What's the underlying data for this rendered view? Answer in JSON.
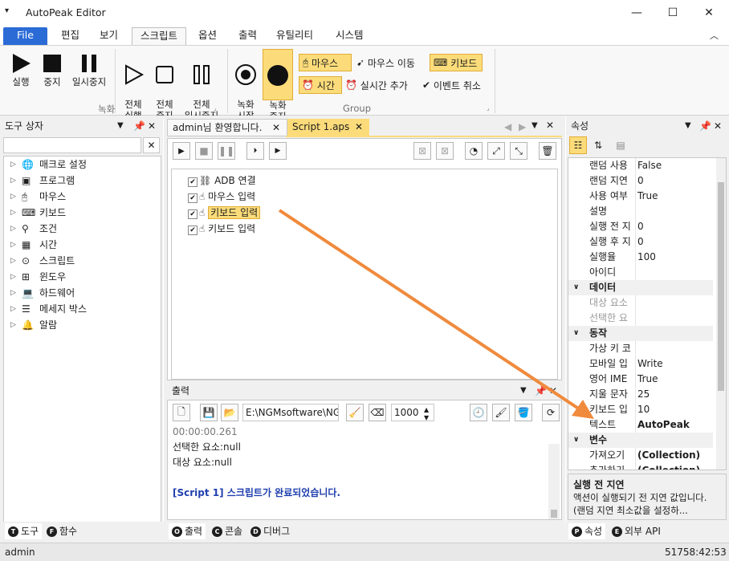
{
  "window": {
    "title": "AutoPeak Editor",
    "minimize": "—",
    "maximize": "☐",
    "close": "✕"
  },
  "menu": {
    "file": "File",
    "items": [
      "편집",
      "보기",
      "스크립트",
      "옵션",
      "출력",
      "유틸리티",
      "시스템"
    ]
  },
  "ribbon": {
    "run": "실행",
    "stop": "중지",
    "pause": "일시중지",
    "run_all": "전체\n실행",
    "stop_all": "전체\n중지",
    "pause_all": "전체\n일시중지",
    "group_record": "녹화",
    "record_start": "녹화\n시작",
    "record_stop": "녹화\n중지",
    "mouse": "마우스",
    "mouse_move": "마우스 이동",
    "keyboard": "키보드",
    "time": "시간",
    "add_realtime": "실시간 추가",
    "cancel_event": "이벤트 취소",
    "group_group": "Group"
  },
  "toolbox": {
    "title": "도구 상자",
    "items": [
      "매크로 설정",
      "프로그램",
      "마우스",
      "키보드",
      "조건",
      "시간",
      "스크립트",
      "윈도우",
      "하드웨어",
      "메세지 박스",
      "알람"
    ]
  },
  "editor": {
    "tabs": [
      "admin님 환영합니다.",
      "Script 1.aps"
    ],
    "nodes": [
      "ADB 연결",
      "마우스 입력",
      "키보드 입력",
      "키보드 입력"
    ]
  },
  "output": {
    "title": "출력",
    "path": "E:\\NGMsoftware\\NG",
    "count": "1000",
    "lines": [
      "00:00:00.261",
      "선택한 요소:null",
      "대상 요소:null",
      "",
      "[Script 1] 스크립트가 완료되었습니다."
    ]
  },
  "properties": {
    "title": "속성",
    "rows": [
      {
        "name": "랜덤 사용",
        "value": "False"
      },
      {
        "name": "랜덤 지연",
        "value": "0"
      },
      {
        "name": "사용 여부",
        "value": "True"
      },
      {
        "name": "설명",
        "value": ""
      },
      {
        "name": "실행 전 지",
        "value": "0"
      },
      {
        "name": "실행 후 지",
        "value": "0"
      },
      {
        "name": "실행율",
        "value": "100"
      },
      {
        "name": "아이디",
        "value": ""
      },
      {
        "name": "데이터",
        "value": "",
        "cat": true
      },
      {
        "name": "대상 요소",
        "value": "",
        "dim": true
      },
      {
        "name": "선택한 요",
        "value": "",
        "dim": true
      },
      {
        "name": "동작",
        "value": "",
        "cat": true
      },
      {
        "name": "가상 키 코",
        "value": ""
      },
      {
        "name": "모바일 입",
        "value": "Write"
      },
      {
        "name": "영어 IME",
        "value": "True"
      },
      {
        "name": "지울 문자",
        "value": "25"
      },
      {
        "name": "키보드 입",
        "value": "10"
      },
      {
        "name": "텍스트",
        "value": "AutoPeak",
        "bold": true
      },
      {
        "name": "변수",
        "value": "",
        "cat": true
      },
      {
        "name": "가져오기",
        "value": "(Collection)",
        "bold": true
      },
      {
        "name": "추가하기",
        "value": "(Collection)",
        "bold": true
      }
    ],
    "desc_title": "실행 전 지연",
    "desc_text": "액션이 실행되기 전 지연 값입니다. (랜덤 지연 최소값을 설정하..."
  },
  "bottom_tabs": {
    "left": [
      "도구",
      "함수"
    ],
    "center": [
      "출력",
      "콘솔",
      "디버그"
    ],
    "right": [
      "속성",
      "외부 API"
    ]
  },
  "status": {
    "user": "admin",
    "clock": "51758:42:53"
  },
  "colors": {
    "accent": "#2b6bd6",
    "highlight": "#fcdc7a",
    "arrow": "#f08a3c",
    "link": "#1f3fae"
  }
}
